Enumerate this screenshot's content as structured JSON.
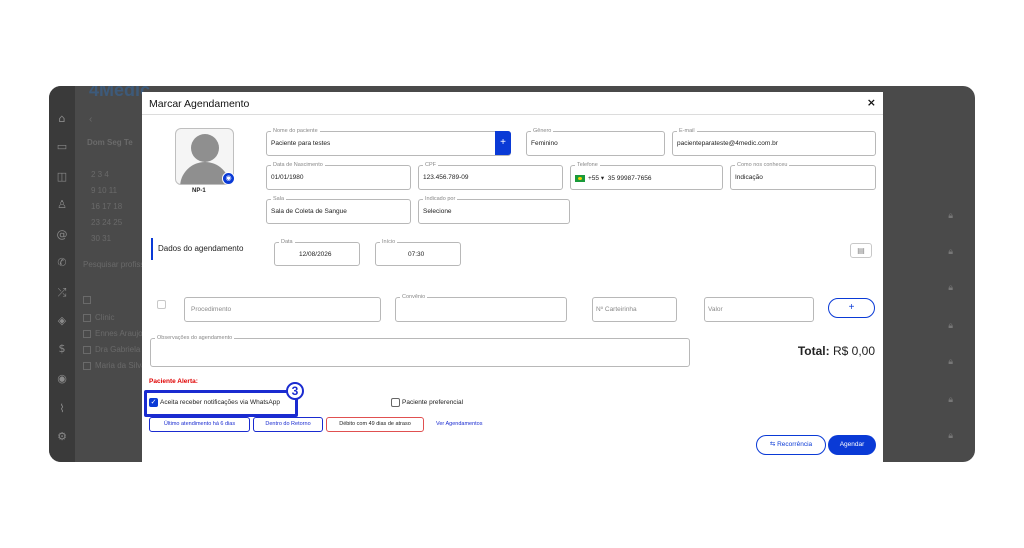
{
  "background": {
    "brand": "4Medic",
    "month_nav_prev": "‹",
    "weekdays": "Dom  Seg  Te",
    "calendar_rows": [
      "2    3    4",
      "9   10   11",
      "16  17  18",
      "23  24  25",
      "30  31"
    ],
    "search_placeholder": "Pesquisar profissi",
    "filter_items": [
      "Clinic",
      "Ennes Araujo",
      "Dra Gabriela N",
      "Maria da Silva"
    ],
    "icons": {
      "home": "home-icon",
      "calendar": "calendar-icon",
      "chat": "chat-icon",
      "user": "user-icon",
      "at": "at-icon",
      "phone": "phone-icon",
      "shuffle": "shuffle-icon",
      "shield": "shield-icon",
      "dollar": "dollar-icon",
      "money": "money-icon",
      "chart": "chart-icon",
      "settings": "settings-icon"
    }
  },
  "modal": {
    "title": "Marcar Agendamento",
    "close": "×",
    "avatar_name": "NP-1",
    "patient": {
      "label": "Nome do paciente",
      "value": "Paciente para testes",
      "add": "+"
    },
    "gender": {
      "label": "Gênero",
      "value": "Feminino"
    },
    "email": {
      "label": "E-mail",
      "value": "pacienteparateste@4medic.com.br"
    },
    "birth": {
      "label": "Data de Nascimento",
      "value": "01/01/1980"
    },
    "cpf": {
      "label": "CPF",
      "value": "123.456.789-09"
    },
    "phone": {
      "label": "Telefone",
      "country": "+55",
      "value": "35 99987-7656"
    },
    "how_known": {
      "label": "Como nos conheceu",
      "value": "Indicação"
    },
    "room": {
      "label": "Sala",
      "value": "Sala de Coleta de Sangue"
    },
    "referred": {
      "label": "Indicado por",
      "value": "Selecione"
    },
    "schedule_section": "Dados do agendamento",
    "date": {
      "label": "Data",
      "value": "12/08/2026"
    },
    "start": {
      "label": "Início",
      "value": "07:30"
    },
    "procedure_placeholder": "Procedimento",
    "insurance_label": "Convênio",
    "card_placeholder": "Nº Carteirinha",
    "value_placeholder": "Valor",
    "add_button": "+",
    "notes_label": "Observações do agendamento",
    "total": {
      "label": "Total:",
      "value": "R$ 0,00"
    },
    "alert_label": "Paciente Alerta:",
    "whatsapp": {
      "label": "Aceita receber notificações via WhatsApp",
      "checked": true
    },
    "preferential": {
      "label": "Paciente preferencial",
      "checked": false
    },
    "step_badge": "3",
    "tags": [
      "Último atendimento há 6 dias",
      "Dentro do Retorno",
      "Débito com 49 dias de atraso"
    ],
    "tags_link": "Ver Agendamentos",
    "recurrence_button": "⇆ Recorrência",
    "schedule_button": "Agendar"
  },
  "colors": {
    "accent": "#0a3ad6",
    "alert": "#e00000",
    "highlight": "#1a2bd0"
  }
}
